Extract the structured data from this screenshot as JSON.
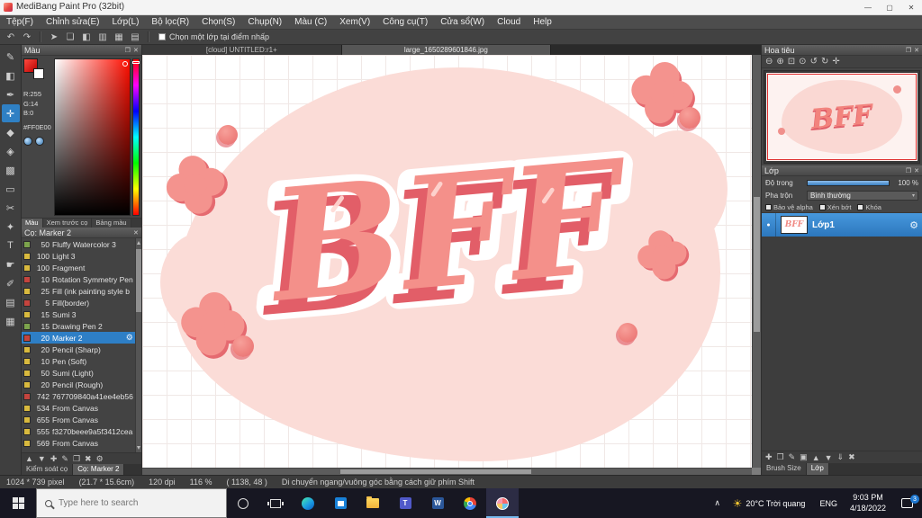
{
  "window": {
    "title": "MediBang Paint Pro (32bit)",
    "minimize": "—",
    "maximize": "▢",
    "close": "✕"
  },
  "menu": {
    "items": [
      "Tệp(F)",
      "Chỉnh sửa(E)",
      "Lớp(L)",
      "Bộ lọc(R)",
      "Chọn(S)",
      "Chụp(N)",
      "Màu (C)",
      "Xem(V)",
      "Công cụ(T)",
      "Cửa sổ(W)",
      "Cloud",
      "Help"
    ]
  },
  "toolbar": {
    "icons": [
      {
        "name": "cursor-icon",
        "glyph": "➤"
      },
      {
        "name": "comment-icon",
        "glyph": "❏"
      },
      {
        "name": "eraser-board-icon",
        "glyph": "◧"
      },
      {
        "name": "panel-left-icon",
        "glyph": "▥"
      },
      {
        "name": "grid-icon",
        "glyph": "▦"
      },
      {
        "name": "table-icon",
        "glyph": "▤"
      }
    ],
    "undo_glyph": "↶",
    "redo_glyph": "↷",
    "checkbox_label": "Chọn một lớp tại điểm nhấp"
  },
  "tools": [
    {
      "name": "pen-tool",
      "glyph": "✎"
    },
    {
      "name": "eraser-tool",
      "glyph": "◧"
    },
    {
      "name": "ink-pen-tool",
      "glyph": "✒"
    },
    {
      "name": "move-tool",
      "glyph": "✛",
      "active": true
    },
    {
      "name": "fill-tool",
      "glyph": "◆"
    },
    {
      "name": "bucket-tool",
      "glyph": "◈"
    },
    {
      "name": "gradient-tool",
      "glyph": "▩"
    },
    {
      "name": "select-tool",
      "glyph": "▭"
    },
    {
      "name": "lasso-tool",
      "glyph": "✂"
    },
    {
      "name": "magic-wand-tool",
      "glyph": "✦"
    },
    {
      "name": "text-tool",
      "glyph": "T"
    },
    {
      "name": "pointer-tool",
      "glyph": "☛"
    },
    {
      "name": "eyedropper-tool",
      "glyph": "✐"
    },
    {
      "name": "divide-tool",
      "glyph": "▤"
    },
    {
      "name": "material-tool",
      "glyph": "▦"
    }
  ],
  "color_panel": {
    "title": "Màu",
    "r": "R:255",
    "g": "G:14",
    "b": "B:0",
    "hex": "#FF0E00",
    "tabs": [
      {
        "label": "Màu",
        "active": true
      },
      {
        "label": "Xem trước cọ",
        "active": false
      },
      {
        "label": "Bảng màu",
        "active": false
      }
    ]
  },
  "brush_panel": {
    "title": "Cọ: Marker 2",
    "gear_glyph": "⚙",
    "brushes": [
      {
        "size": "50",
        "name": "Fluffy Watercolor 3",
        "color": "#7ca34c"
      },
      {
        "size": "100",
        "name": "Light 3",
        "color": "#d8b93e"
      },
      {
        "size": "100",
        "name": "Fragment",
        "color": "#d8b93e"
      },
      {
        "size": "10",
        "name": "Rotation Symmetry Pen",
        "color": "#c4443e"
      },
      {
        "size": "25",
        "name": "Fill (ink painting style b",
        "color": "#d8b93e"
      },
      {
        "size": "5",
        "name": "Fill(border)",
        "color": "#c4443e"
      },
      {
        "size": "15",
        "name": "Sumi 3",
        "color": "#d8b93e"
      },
      {
        "size": "15",
        "name": "Drawing Pen 2",
        "color": "#7ca34c"
      },
      {
        "size": "20",
        "name": "Marker 2",
        "color": "#c4443e",
        "selected": true
      },
      {
        "size": "20",
        "name": "Pencil (Sharp)",
        "color": "#d8b93e"
      },
      {
        "size": "10",
        "name": "Pen (Soft)",
        "color": "#d8b93e"
      },
      {
        "size": "50",
        "name": "Sumi (Light)",
        "color": "#d8b93e"
      },
      {
        "size": "20",
        "name": "Pencil (Rough)",
        "color": "#d8b93e"
      },
      {
        "size": "742",
        "name": "767709840a41ee4eb56",
        "color": "#c4443e"
      },
      {
        "size": "534",
        "name": "From Canvas",
        "color": "#d8b93e"
      },
      {
        "size": "655",
        "name": "From Canvas",
        "color": "#d8b93e"
      },
      {
        "size": "555",
        "name": "f3270beee9a5f3412cea",
        "color": "#d8b93e"
      },
      {
        "size": "569",
        "name": "From Canvas",
        "color": "#d8b93e"
      }
    ],
    "bottom_icons": [
      {
        "name": "brush-up-icon",
        "glyph": "▲"
      },
      {
        "name": "brush-down-icon",
        "glyph": "▼"
      },
      {
        "name": "add-brush-icon",
        "glyph": "✚"
      },
      {
        "name": "edit-brush-icon",
        "glyph": "✎"
      },
      {
        "name": "duplicate-brush-icon",
        "glyph": "❐"
      },
      {
        "name": "delete-brush-icon",
        "glyph": "✖"
      },
      {
        "name": "brush-settings-icon",
        "glyph": "⚙"
      }
    ],
    "tabs": [
      {
        "label": "Kiểm soát cọ",
        "active": false
      },
      {
        "label": "Cọ: Marker 2",
        "active": true
      }
    ]
  },
  "doc_tabs": [
    {
      "label": "[cloud] UNTITLED:r1+",
      "active": false
    },
    {
      "label": "large_1650289601846.jpg",
      "active": true
    }
  ],
  "canvas": {
    "artwork_text": "BFF"
  },
  "navigator": {
    "title": "Hoa tiêu",
    "zoom_icons": [
      {
        "name": "zoom-out-icon",
        "glyph": "⊖"
      },
      {
        "name": "zoom-in-icon",
        "glyph": "⊕"
      },
      {
        "name": "zoom-fit-icon",
        "glyph": "⊡"
      },
      {
        "name": "zoom-actual-icon",
        "glyph": "⊙"
      },
      {
        "name": "rotate-ccw-icon",
        "glyph": "↺"
      },
      {
        "name": "rotate-cw-icon",
        "glyph": "↻"
      },
      {
        "name": "reset-view-icon",
        "glyph": "✛"
      }
    ]
  },
  "layers": {
    "title": "Lớp",
    "opacity_label": "Độ trong",
    "opacity_value": "100 %",
    "blend_label": "Pha trộn",
    "blend_value": "Bình thường",
    "blend_arrow": "▾",
    "checkboxes": [
      {
        "label": "Bảo vệ alpha"
      },
      {
        "label": "Xén bớt"
      },
      {
        "label": "Khóa"
      }
    ],
    "visible_glyph": "●",
    "layer_name": "Lớp1",
    "gear_glyph": "⚙",
    "bottom_icons": [
      {
        "name": "add-layer-icon",
        "glyph": "✚"
      },
      {
        "name": "duplicate-layer-icon",
        "glyph": "❐"
      },
      {
        "name": "edit-layer-icon",
        "glyph": "✎"
      },
      {
        "name": "layer-folder-icon",
        "glyph": "▣"
      },
      {
        "name": "layer-up-icon",
        "glyph": "▲"
      },
      {
        "name": "layer-down-icon",
        "glyph": "▼"
      },
      {
        "name": "merge-layer-icon",
        "glyph": "⇓"
      },
      {
        "name": "delete-layer-icon",
        "glyph": "✖"
      }
    ],
    "bottom_tabs": [
      {
        "label": "Brush Size",
        "active": false
      },
      {
        "label": "Lớp",
        "active": true
      }
    ]
  },
  "statusbar": {
    "items": [
      "1024 * 739 pixel",
      "(21.7 * 15.6cm)",
      "120 dpi",
      "116 %",
      "( 1138, 48 )",
      "Di chuyển ngang/vuông góc bằng cách giữ phím Shift"
    ]
  },
  "taskbar": {
    "search_placeholder": "Type here to search",
    "teams_letter": "T",
    "word_letter": "W",
    "chevron": "∧",
    "sun_glyph": "☀",
    "weather": "20°C Trời quang",
    "lang": "ENG",
    "time": "9:03 PM",
    "date": "4/18/2022",
    "notification_count": "3"
  }
}
